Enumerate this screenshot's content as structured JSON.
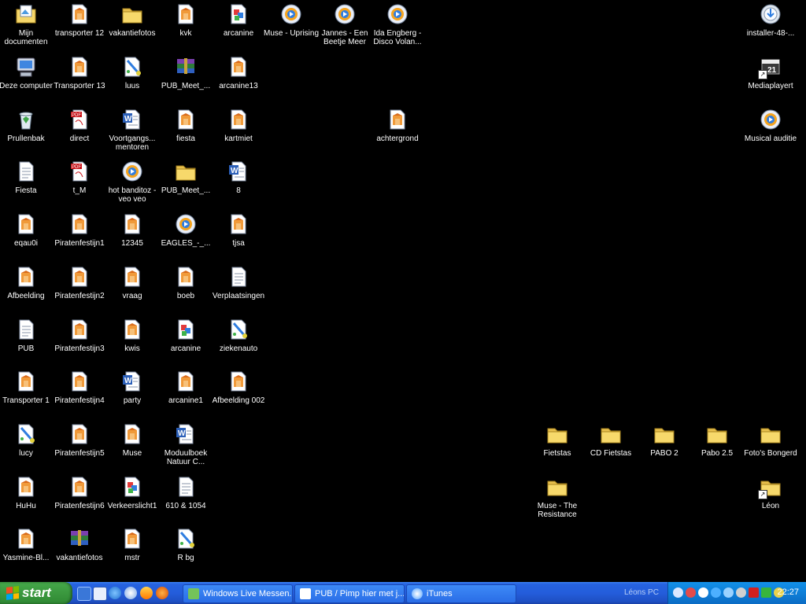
{
  "desktop": {
    "icons": [
      {
        "label": "Mijn documenten",
        "type": "mydocs"
      },
      {
        "label": "Deze computer",
        "type": "computer"
      },
      {
        "label": "Prullenbak",
        "type": "recycle"
      },
      {
        "label": "Fiesta",
        "type": "text"
      },
      {
        "label": "eqau0i",
        "type": "image"
      },
      {
        "label": "Afbeelding",
        "type": "image"
      },
      {
        "label": "PUB",
        "type": "text"
      },
      {
        "label": "Transporter 1",
        "type": "image"
      },
      {
        "label": "lucy",
        "type": "paint"
      },
      {
        "label": "HuHu",
        "type": "image"
      },
      {
        "label": "Yasmine-Bl...",
        "type": "image"
      },
      {
        "label": "transporter 12",
        "type": "image"
      },
      {
        "label": "Transporter 13",
        "type": "image"
      },
      {
        "label": "direct",
        "type": "pdf"
      },
      {
        "label": "t_M",
        "type": "pdf"
      },
      {
        "label": "Piratenfestijn1",
        "type": "image"
      },
      {
        "label": "Piratenfestijn2",
        "type": "image"
      },
      {
        "label": "Piratenfestijn3",
        "type": "image"
      },
      {
        "label": "Piratenfestijn4",
        "type": "image"
      },
      {
        "label": "Piratenfestijn5",
        "type": "image"
      },
      {
        "label": "Piratenfestijn6",
        "type": "image"
      },
      {
        "label": "vakantiefotos",
        "type": "rar"
      },
      {
        "label": "vakantiefotos",
        "type": "folder"
      },
      {
        "label": "luus",
        "type": "paint"
      },
      {
        "label": "Voortgangs... mentoren",
        "type": "word"
      },
      {
        "label": "hot banditoz - veo veo",
        "type": "media"
      },
      {
        "label": "12345",
        "type": "image"
      },
      {
        "label": "vraag",
        "type": "image"
      },
      {
        "label": "kwis",
        "type": "image"
      },
      {
        "label": "party",
        "type": "word"
      },
      {
        "label": "Muse",
        "type": "image"
      },
      {
        "label": "Verkeerslicht1",
        "type": "picture"
      },
      {
        "label": "mstr",
        "type": "image"
      },
      {
        "label": "kvk",
        "type": "image"
      },
      {
        "label": "PUB_Meet_...",
        "type": "rar"
      },
      {
        "label": "fiesta",
        "type": "image"
      },
      {
        "label": "PUB_Meet_...",
        "type": "folder"
      },
      {
        "label": "EAGLES_-_...",
        "type": "media"
      },
      {
        "label": "boeb",
        "type": "image"
      },
      {
        "label": "arcanine",
        "type": "picture"
      },
      {
        "label": "arcanine1",
        "type": "image"
      },
      {
        "label": "Moduulboek Natuur C...",
        "type": "word"
      },
      {
        "label": "610 & 1054",
        "type": "text"
      },
      {
        "label": "R bg",
        "type": "paint"
      },
      {
        "label": "arcanine",
        "type": "picture"
      },
      {
        "label": "arcanine13",
        "type": "image"
      },
      {
        "label": "kartmiet",
        "type": "image"
      },
      {
        "label": "8",
        "type": "word"
      },
      {
        "label": "tjsa",
        "type": "image"
      },
      {
        "label": "Verplaatsingen",
        "type": "text"
      },
      {
        "label": "ziekenauto",
        "type": "paint"
      },
      {
        "label": "Afbeelding 002",
        "type": "image"
      },
      {
        "label": "Muse - Uprising",
        "type": "media"
      },
      {
        "label": "Jannes - Een Beetje Meer",
        "type": "media"
      },
      {
        "label": "Ida Engberg - Disco Volan...",
        "type": "media"
      },
      {
        "label": "achtergrond",
        "type": "image"
      },
      {
        "label": "installer-48-...",
        "type": "installer"
      },
      {
        "label": "Mediaplayert",
        "type": "mpc"
      },
      {
        "label": "Musical auditie",
        "type": "media"
      },
      {
        "label": "Fietstas",
        "type": "folder"
      },
      {
        "label": "CD Fietstas",
        "type": "folder"
      },
      {
        "label": "PABO 2",
        "type": "folder"
      },
      {
        "label": "Pabo 2.5",
        "type": "folder"
      },
      {
        "label": "Foto's Bongerd",
        "type": "folder"
      },
      {
        "label": "Muse - The Resistance",
        "type": "folder"
      },
      {
        "label": "Léon",
        "type": "folder"
      }
    ]
  },
  "taskbar": {
    "start_label": "start",
    "tasks": [
      {
        "label": "Windows Live Messen..."
      },
      {
        "label": "PUB / Pimp hier met j..."
      },
      {
        "label": "iTunes"
      }
    ],
    "pc_name": "Léons PC",
    "clock": "22:27"
  },
  "colors": {
    "desktop_bg": "#000000",
    "taskbar": "#245ddb",
    "start": "#3c9a40",
    "tray": "#0f7fd8"
  }
}
